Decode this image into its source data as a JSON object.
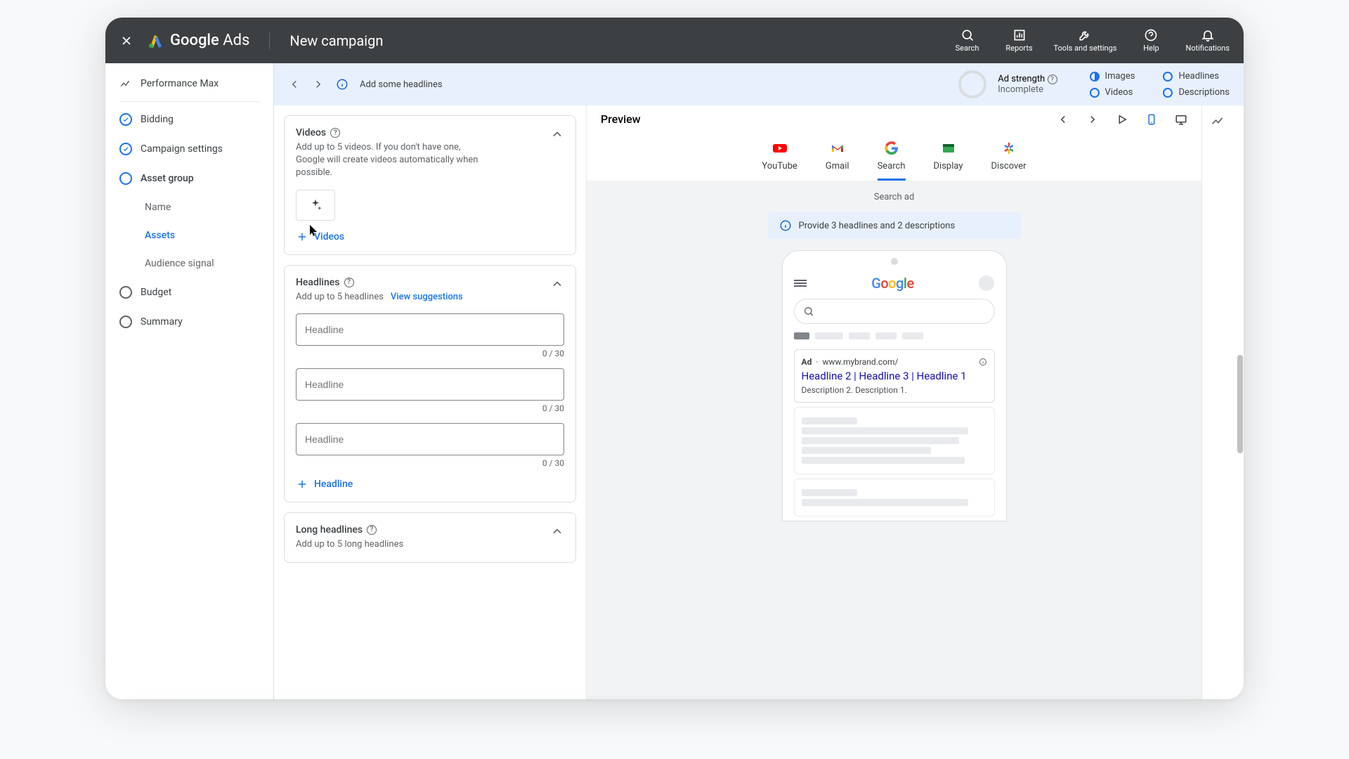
{
  "topbar": {
    "product": "Google",
    "product_suffix": "Ads",
    "page_title": "New campaign",
    "actions": [
      {
        "label": "Search"
      },
      {
        "label": "Reports"
      },
      {
        "label": "Tools and settings"
      },
      {
        "label": "Help"
      },
      {
        "label": "Notifications"
      }
    ]
  },
  "sidebar": {
    "campaign_type": "Performance Max",
    "items": [
      {
        "label": "Bidding"
      },
      {
        "label": "Campaign settings"
      },
      {
        "label": "Asset group"
      },
      {
        "label": "Budget"
      },
      {
        "label": "Summary"
      }
    ],
    "sub": [
      {
        "label": "Name"
      },
      {
        "label": "Assets"
      },
      {
        "label": "Audience signal"
      }
    ]
  },
  "strength": {
    "hint": "Add some headlines",
    "title": "Ad strength",
    "status": "Incomplete",
    "checks": {
      "images": "Images",
      "videos": "Videos",
      "headlines": "Headlines",
      "descriptions": "Descriptions"
    }
  },
  "editor": {
    "videos": {
      "title": "Videos",
      "desc": "Add up to 5 videos. If you don't have one, Google will create videos automatically when possible.",
      "add": "Videos"
    },
    "headlines": {
      "title": "Headlines",
      "desc": "Add up to 5 headlines",
      "view": "View suggestions",
      "placeholder": "Headline",
      "counter": "0 / 30",
      "add": "Headline"
    },
    "long": {
      "title": "Long headlines",
      "desc": "Add up to 5 long headlines"
    }
  },
  "preview": {
    "title": "Preview",
    "tabs": [
      "YouTube",
      "Gmail",
      "Search",
      "Display",
      "Discover"
    ],
    "ad_type": "Search ad",
    "banner": "Provide 3 headlines and 2 descriptions",
    "ad": {
      "badge": "Ad",
      "url": "www.mybrand.com/",
      "headline": "Headline 2 | Headline 3 | Headline 1",
      "desc": "Description 2. Description 1."
    }
  }
}
